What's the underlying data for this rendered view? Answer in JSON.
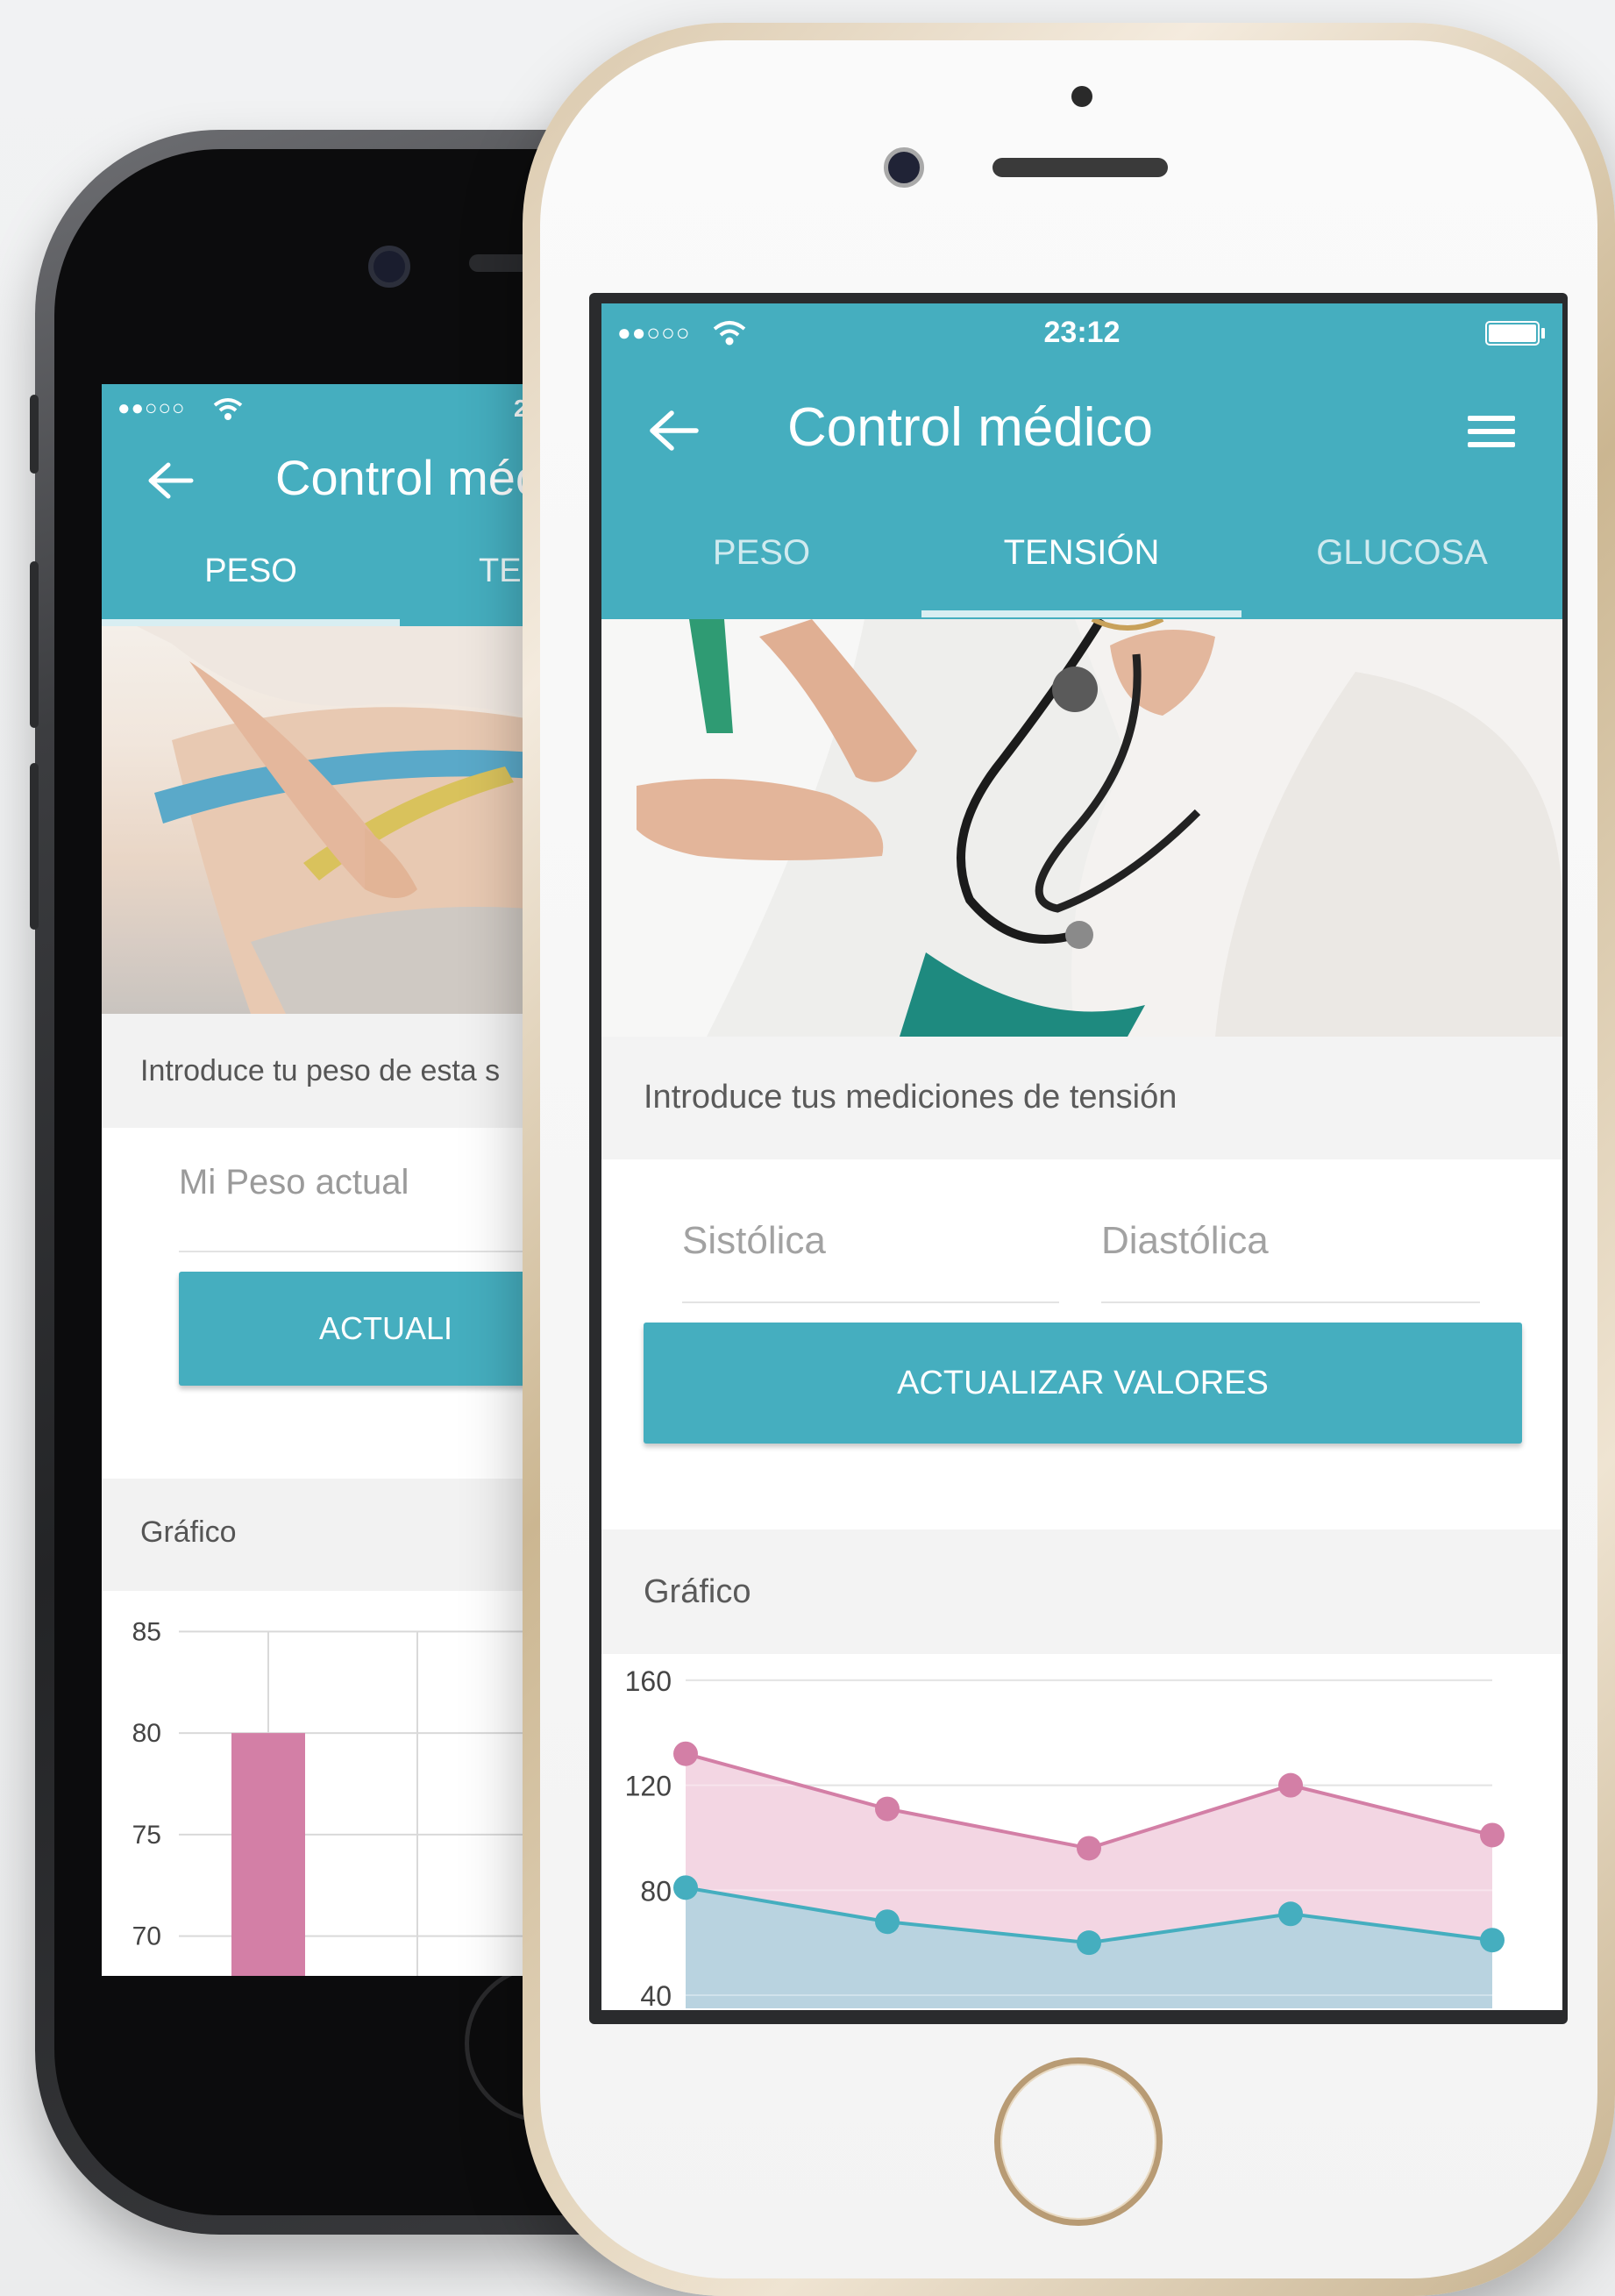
{
  "colors": {
    "accent": "#45aebf",
    "systolic": "#d37fa6",
    "diastolic": "#45aebf"
  },
  "front_screen": {
    "status": {
      "signal": "●●○○○",
      "time": "23:12",
      "wifi_icon": "wifi-icon",
      "battery_icon": "battery-icon"
    },
    "header": {
      "back_icon": "back-arrow-icon",
      "title": "Control médico",
      "menu_icon": "hamburger-menu-icon"
    },
    "tabs": [
      "PESO",
      "TENSIÓN",
      "GLUCOSA"
    ],
    "active_tab": "TENSIÓN",
    "intro": "Introduce tus mediciones de tensión",
    "form": {
      "systolic_placeholder": "Sistólica",
      "diastolic_placeholder": "Diastólica",
      "button": "ACTUALIZAR VALORES"
    },
    "chart_section_title": "Gráfico"
  },
  "back_screen": {
    "status": {
      "signal": "●●○○○",
      "time_fragment": "2"
    },
    "header": {
      "title_fragment": "Control méc"
    },
    "tabs": [
      "PESO",
      "TE"
    ],
    "active_tab": "PESO",
    "intro": "Introduce tu peso de esta s",
    "form": {
      "weight_placeholder": "Mi Peso actual",
      "button_fragment": "ACTUALI"
    },
    "chart_section_title": "Gráfico"
  },
  "chart_data": [
    {
      "type": "area",
      "x": [
        1,
        2,
        3,
        4,
        5
      ],
      "series": [
        {
          "values": [
            132,
            111,
            96,
            120,
            101
          ],
          "color": "#d37fa6"
        },
        {
          "values": [
            81,
            68,
            60,
            71,
            61
          ],
          "color": "#45aebf"
        }
      ],
      "y_ticks": [
        160,
        120,
        80,
        40
      ],
      "ylim": [
        35,
        170
      ],
      "grid": true
    },
    {
      "type": "bar",
      "categories": [
        "",
        "",
        ""
      ],
      "values": [
        80,
        null,
        null
      ],
      "bar_color": "#d37fa6",
      "y_ticks": [
        85,
        80,
        75,
        70
      ],
      "ylim": [
        68,
        87
      ],
      "grid": true
    }
  ]
}
